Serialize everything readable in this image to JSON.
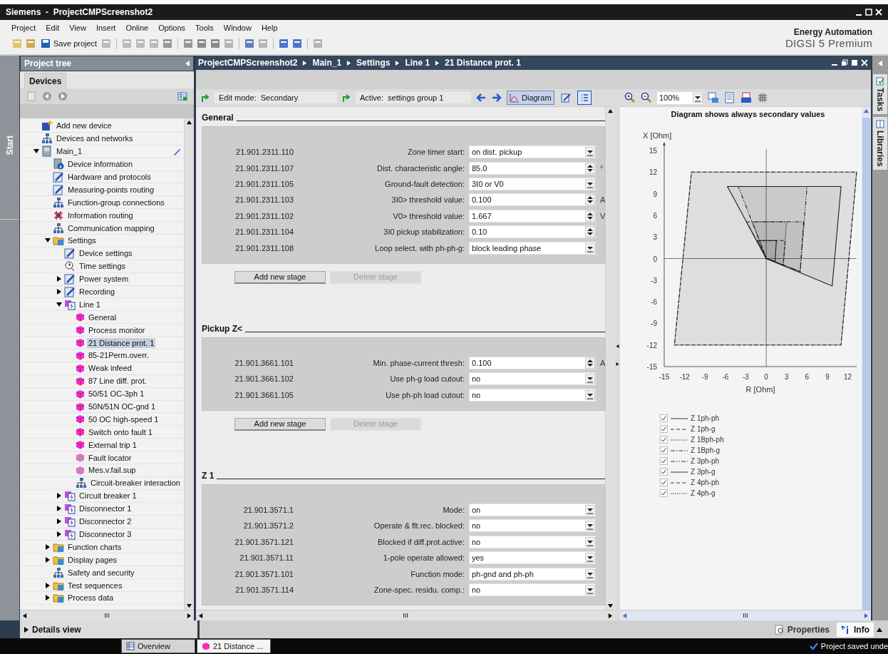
{
  "window": {
    "title": "Siemens  -  ProjectCMPScreenshot2"
  },
  "menu": [
    "Project",
    "Edit",
    "View",
    "Insert",
    "Online",
    "Options",
    "Tools",
    "Window",
    "Help"
  ],
  "toolbar": {
    "save_label": "Save project"
  },
  "brand": {
    "line1": "Energy Automation",
    "line2": "DIGSI 5 Premium"
  },
  "side_tabs": {
    "start": "Start",
    "tasks": "Tasks",
    "libraries": "Libraries"
  },
  "project_tree": {
    "title": "Project tree",
    "tab": "Devices",
    "items": [
      {
        "label": "Add new device",
        "kind": "add",
        "selected": false
      },
      {
        "label": "Devices and networks",
        "kind": "network",
        "selected": false
      },
      {
        "label": "Main_1",
        "kind": "device",
        "selected": false,
        "expanded": true,
        "edited": true,
        "children": [
          {
            "label": "Device information",
            "kind": "info",
            "selected": false
          },
          {
            "label": "Hardware and protocols",
            "kind": "tool",
            "selected": false
          },
          {
            "label": "Measuring-points routing",
            "kind": "tool",
            "selected": false
          },
          {
            "label": "Function-group connections",
            "kind": "network",
            "selected": false
          },
          {
            "label": "Information routing",
            "kind": "matrix",
            "selected": false
          },
          {
            "label": "Communication mapping",
            "kind": "network",
            "selected": false
          },
          {
            "label": "Settings",
            "kind": "folder",
            "selected": false,
            "expanded": true,
            "children": [
              {
                "label": "Device settings",
                "kind": "tool",
                "selected": false
              },
              {
                "label": "Time settings",
                "kind": "clock",
                "selected": false
              },
              {
                "label": "Power system",
                "kind": "tool",
                "selected": false,
                "expanded": false
              },
              {
                "label": "Recording",
                "kind": "tool",
                "selected": false,
                "expanded": false
              },
              {
                "label": "Line 1",
                "kind": "function",
                "selected": false,
                "expanded": true,
                "children": [
                  {
                    "label": "General",
                    "kind": "stage",
                    "selected": false
                  },
                  {
                    "label": "Process monitor",
                    "kind": "stage",
                    "selected": false
                  },
                  {
                    "label": "21 Distance prot. 1",
                    "kind": "stage",
                    "selected": true
                  },
                  {
                    "label": "85-21Perm.overr.",
                    "kind": "stage",
                    "selected": false
                  },
                  {
                    "label": "Weak infeed",
                    "kind": "stage",
                    "selected": false
                  },
                  {
                    "label": "87 Line diff. prot.",
                    "kind": "stage",
                    "selected": false
                  },
                  {
                    "label": "50/51 OC-3ph 1",
                    "kind": "stage",
                    "selected": false
                  },
                  {
                    "label": "50N/51N OC-gnd 1",
                    "kind": "stage",
                    "selected": false
                  },
                  {
                    "label": "50 OC high-speed 1",
                    "kind": "stage",
                    "selected": false
                  },
                  {
                    "label": "Switch onto fault 1",
                    "kind": "stage",
                    "selected": false
                  },
                  {
                    "label": "External trip 1",
                    "kind": "stage",
                    "selected": false
                  },
                  {
                    "label": "Fault locator",
                    "kind": "stage_off",
                    "selected": false
                  },
                  {
                    "label": "Mes.v.fail.sup",
                    "kind": "stage_off",
                    "selected": false
                  },
                  {
                    "label": "Circuit-breaker interaction",
                    "kind": "network",
                    "selected": false
                  }
                ]
              },
              {
                "label": "Circuit breaker 1",
                "kind": "function",
                "selected": false,
                "expanded": false
              },
              {
                "label": "Disconnector 1",
                "kind": "function",
                "selected": false,
                "expanded": false
              },
              {
                "label": "Disconnector 2",
                "kind": "function",
                "selected": false,
                "expanded": false
              },
              {
                "label": "Disconnector 3",
                "kind": "function",
                "selected": false,
                "expanded": false
              }
            ]
          },
          {
            "label": "Function charts",
            "kind": "folder",
            "selected": false,
            "expanded": false
          },
          {
            "label": "Display pages",
            "kind": "folder",
            "selected": false,
            "expanded": false
          },
          {
            "label": "Safety and security",
            "kind": "network",
            "selected": false
          },
          {
            "label": "Test sequences",
            "kind": "folder",
            "selected": false,
            "expanded": false
          },
          {
            "label": "Process data",
            "kind": "folder",
            "selected": false,
            "expanded": false
          }
        ]
      }
    ]
  },
  "editor": {
    "breadcrumb": [
      "ProjectCMPScreenshot2",
      "Main_1",
      "Settings",
      "Line 1",
      "21 Distance prot. 1"
    ],
    "edit_mode": {
      "label": "Edit mode:",
      "value": "Secondary"
    },
    "active": {
      "label": "Active:",
      "value": "settings group 1"
    },
    "diagram_button": {
      "label": "Diagram",
      "selected": true
    },
    "list_view_button": {
      "selected": true
    },
    "sections": [
      {
        "title": "General",
        "rows": [
          {
            "id": "21.901.2311.110",
            "label": "Zone timer start:",
            "value": "on dist. pickup",
            "kind": "dropdown"
          },
          {
            "id": "21.901.2311.107",
            "label": "Dist. characteristic angle:",
            "value": "85.0",
            "kind": "spin",
            "unit": "°"
          },
          {
            "id": "21.901.2311.105",
            "label": "Ground-fault detection:",
            "value": "3I0 or V0",
            "kind": "dropdown"
          },
          {
            "id": "21.901.2311.103",
            "label": "3I0> threshold value:",
            "value": "0.100",
            "kind": "spin",
            "unit": "A"
          },
          {
            "id": "21.901.2311.102",
            "label": "V0> threshold value:",
            "value": "1.667",
            "kind": "spin",
            "unit": "V"
          },
          {
            "id": "21.901.2311.104",
            "label": "3I0 pickup stabilization:",
            "value": "0.10",
            "kind": "spin"
          },
          {
            "id": "21.901.2311.108",
            "label": "Loop select. with ph-ph-g:",
            "value": "block leading phase",
            "kind": "dropdown"
          }
        ],
        "buttons": [
          {
            "label": "Add new stage",
            "disabled": false
          },
          {
            "label": "Delete stage",
            "disabled": true
          }
        ]
      },
      {
        "title": "Pickup Z<",
        "rows": [
          {
            "id": "21.901.3661.101",
            "label": "Min. phase-current thresh:",
            "value": "0.100",
            "kind": "spin",
            "unit": "A"
          },
          {
            "id": "21.901.3661.102",
            "label": "Use ph-g load cutout:",
            "value": "no",
            "kind": "dropdown"
          },
          {
            "id": "21.901.3661.105",
            "label": "Use ph-ph load cutout:",
            "value": "no",
            "kind": "dropdown"
          }
        ],
        "buttons": [
          {
            "label": "Add new stage",
            "disabled": false
          },
          {
            "label": "Delete stage",
            "disabled": true
          }
        ]
      },
      {
        "title": "Z 1",
        "rows": [
          {
            "id": "21.901.3571.1",
            "label": "Mode:",
            "value": "on",
            "kind": "dropdown"
          },
          {
            "id": "21.901.3571.2",
            "label": "Operate & flt.rec. blocked:",
            "value": "no",
            "kind": "dropdown"
          },
          {
            "id": "21.901.3571.121",
            "label": "Blocked if diff.prot.active:",
            "value": "no",
            "kind": "dropdown"
          },
          {
            "id": "21.901.3571.11",
            "label": "1-pole operate allowed:",
            "value": "yes",
            "kind": "dropdown"
          },
          {
            "id": "21.901.3571.101",
            "label": "Function mode:",
            "value": "ph-gnd and ph-ph",
            "kind": "dropdown"
          },
          {
            "id": "21.901.3571.114",
            "label": "Zone-spec. residu. comp.:",
            "value": "no",
            "kind": "dropdown"
          }
        ]
      }
    ],
    "diagram": {
      "zoom": "100%",
      "title": "Diagram shows always secondary values",
      "x_label": "R [Ohm]",
      "y_label": "X [Ohm]",
      "x_ticks": [
        "-15",
        "-12",
        "-9",
        "-6",
        "-3",
        "0",
        "3",
        "6",
        "9",
        "12"
      ],
      "y_ticks": [
        "15",
        "12",
        "9",
        "6",
        "3",
        "0",
        "-3",
        "-6",
        "-9",
        "-12",
        "-15"
      ],
      "legend": [
        {
          "label": "Z 1ph-ph",
          "checked": true,
          "kind": "solid"
        },
        {
          "label": "Z 1ph-g",
          "checked": true,
          "kind": "dashed"
        },
        {
          "label": "Z 1Bph-ph",
          "checked": true,
          "kind": "dotted"
        },
        {
          "label": "Z 1Bph-g",
          "checked": true,
          "kind": "dashdot"
        },
        {
          "label": "Z 3ph-ph",
          "checked": true,
          "kind": "dashdotdot"
        },
        {
          "label": "Z 3ph-g",
          "checked": true,
          "kind": "solid"
        },
        {
          "label": "Z 4ph-ph",
          "checked": true,
          "kind": "dashed"
        },
        {
          "label": "Z 4ph-g",
          "checked": true,
          "kind": "dotted"
        }
      ]
    }
  },
  "bottom": {
    "details": "Details view",
    "tabs": [
      {
        "label": "Properties",
        "selected": false
      },
      {
        "label": "Info",
        "selected": true
      }
    ]
  },
  "taskbar": {
    "items": [
      {
        "label": "Overview",
        "selected": false
      },
      {
        "label": "21 Distance ...",
        "selected": true
      }
    ],
    "status": "Project saved unde"
  }
}
